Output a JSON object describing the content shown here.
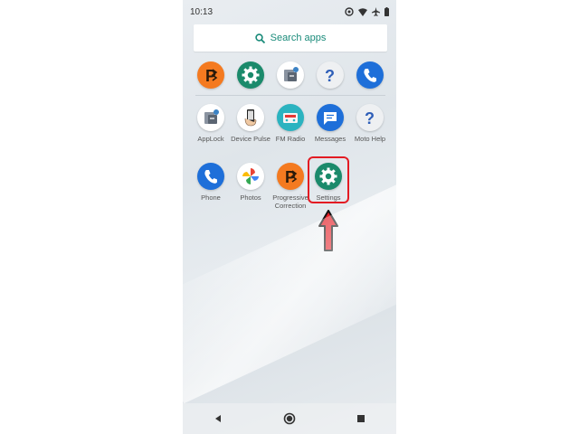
{
  "status_bar": {
    "time": "10:13"
  },
  "search": {
    "label": "Search apps"
  },
  "apps": {
    "progressive": "Progressive Correction",
    "settings": "Settings",
    "applock": "AppLock",
    "device_pulse": "Device Pulse",
    "fm_radio": "FM Radio",
    "messages": "Messages",
    "moto_help": "Moto Help",
    "phone": "Phone",
    "photos": "Photos"
  },
  "colors": {
    "accent": "#1a8b7a",
    "settings_green": "#1b8a6b",
    "phone_blue": "#1e6fd9",
    "highlight_red": "#e31b23",
    "progressive_orange": "#f47a20"
  },
  "icons": {
    "search": "search-icon",
    "settings": "gear-icon",
    "phone": "phone-icon",
    "help": "question-mark-icon",
    "messages": "chat-bubble-icon",
    "arrow": "arrow-up-icon"
  }
}
